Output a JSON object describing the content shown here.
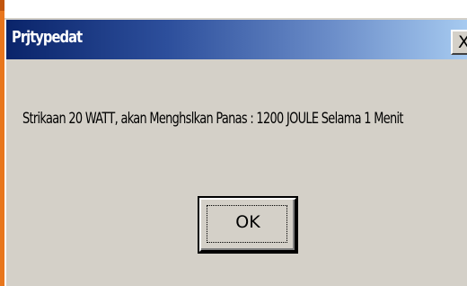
{
  "dialog": {
    "title": "Prjtypedat",
    "close_label": "X",
    "message": "Strikaan  20 WATT, akan Menghslkan Panas : 1200 JOULE Selama 1 Menit",
    "ok_label": "OK"
  },
  "colors": {
    "titlebar_start": "#0a246a",
    "titlebar_end": "#a6caf0",
    "dialog_face": "#d4d0c8",
    "accent_left": "#e8761c"
  }
}
